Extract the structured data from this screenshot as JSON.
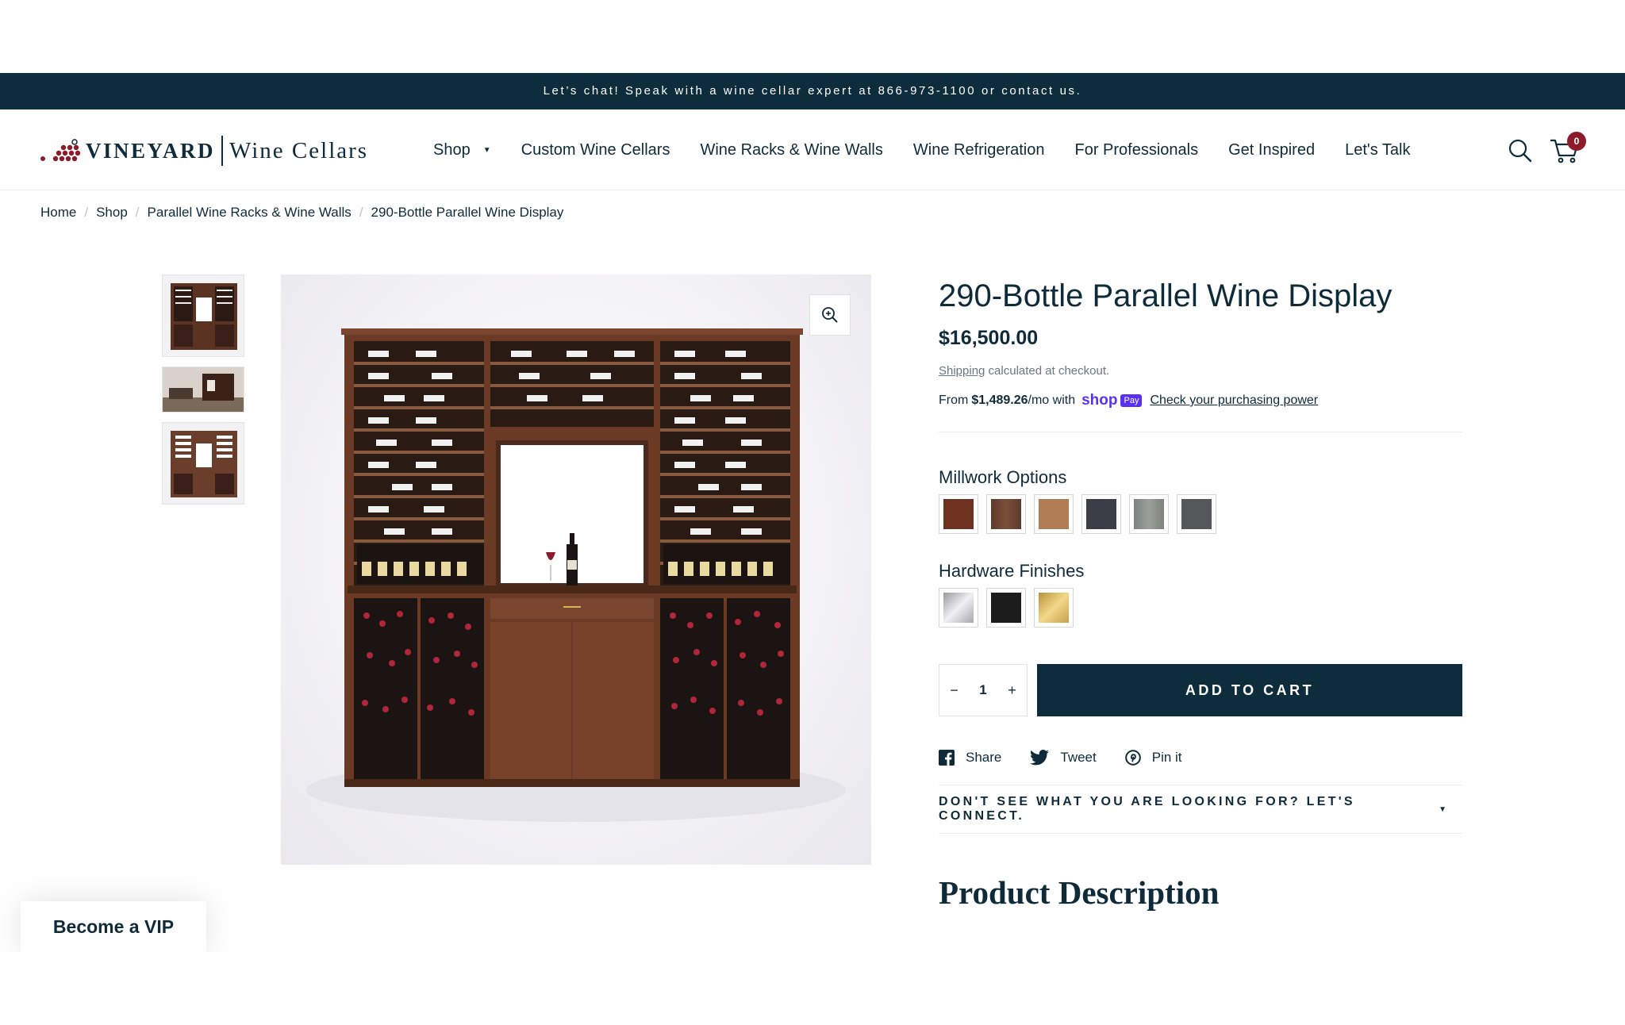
{
  "announcement": "Let’s chat! Speak with a wine cellar expert at 866-973-1100 or contact us.",
  "logo": {
    "word1": "VINEYARD",
    "word2": "Wine Cellars"
  },
  "nav": {
    "items": [
      "Shop",
      "Custom Wine Cellars",
      "Wine Racks & Wine Walls",
      "Wine Refrigeration",
      "For Professionals",
      "Get Inspired",
      "Let's Talk"
    ]
  },
  "cart": {
    "count": "0"
  },
  "breadcrumb": [
    "Home",
    "Shop",
    "Parallel Wine Racks & Wine Walls",
    "290-Bottle Parallel Wine Display"
  ],
  "product": {
    "title": "290-Bottle Parallel Wine Display",
    "price": "$16,500.00",
    "shipping_link": "Shipping",
    "shipping_text": " calculated at checkout.",
    "shoppay_prefix": "From",
    "shoppay_amount": "$1,489.26",
    "shoppay_suffix": "/mo with",
    "shoppay_logo": "shop",
    "shoppay_badge": "Pay",
    "shoppay_link": "Check your purchasing power"
  },
  "millwork": {
    "label": "Millwork Options",
    "colors": [
      "#6e3320",
      "#5e3a2a",
      "#b07c55",
      "#3b3e46",
      "#8a8f8a",
      "#55585a"
    ]
  },
  "hardware": {
    "label": "Hardware Finishes",
    "colors": [
      "#c9c9cb",
      "#1c1c1c",
      "#d8b45a"
    ]
  },
  "quantity": {
    "minus": "−",
    "value": "1",
    "plus": "+"
  },
  "add_to_cart": "ADD TO CART",
  "social": {
    "share": "Share",
    "tweet": "Tweet",
    "pin": "Pin it"
  },
  "accordion": "DON'T SEE WHAT YOU ARE LOOKING FOR? LET'S CONNECT.",
  "description_title": "Product Description",
  "vip": "Become a VIP"
}
